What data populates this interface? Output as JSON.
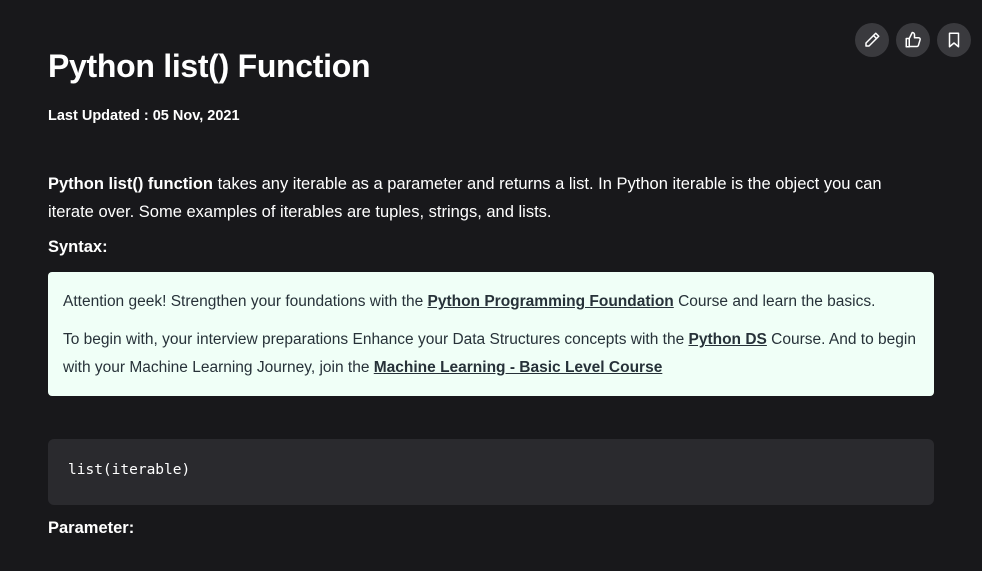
{
  "article": {
    "title": "Python list() Function",
    "last_updated": "Last Updated : 05 Nov, 2021",
    "intro_bold": "Python list() function",
    "intro_rest": " takes any iterable as a parameter and returns a list. In Python iterable is the object you can iterate over. Some examples of iterables are tuples, strings, and lists.",
    "syntax_heading": "Syntax:",
    "code": "list(iterable)",
    "parameter_heading": "Parameter:"
  },
  "promo": {
    "p1_before": " Attention geek! Strengthen your foundations with the ",
    "p1_link": "Python Programming Foundation",
    "p1_after": " Course and learn the basics.",
    "p2_before": "To begin with, your interview preparations Enhance your Data Structures concepts with the ",
    "p2_link1": "Python DS",
    "p2_mid": " Course. And to begin with your Machine Learning Journey, join the ",
    "p2_link2": "Machine Learning - Basic Level Course",
    "background": "#f0fff7"
  },
  "actions": {
    "edit_icon": "pencil-icon",
    "like_icon": "thumbs-up-icon",
    "bookmark_icon": "bookmark-icon"
  },
  "colors": {
    "page_background": "#18181b",
    "code_background": "#2a2a2e",
    "action_button": "#3a3a3e"
  }
}
